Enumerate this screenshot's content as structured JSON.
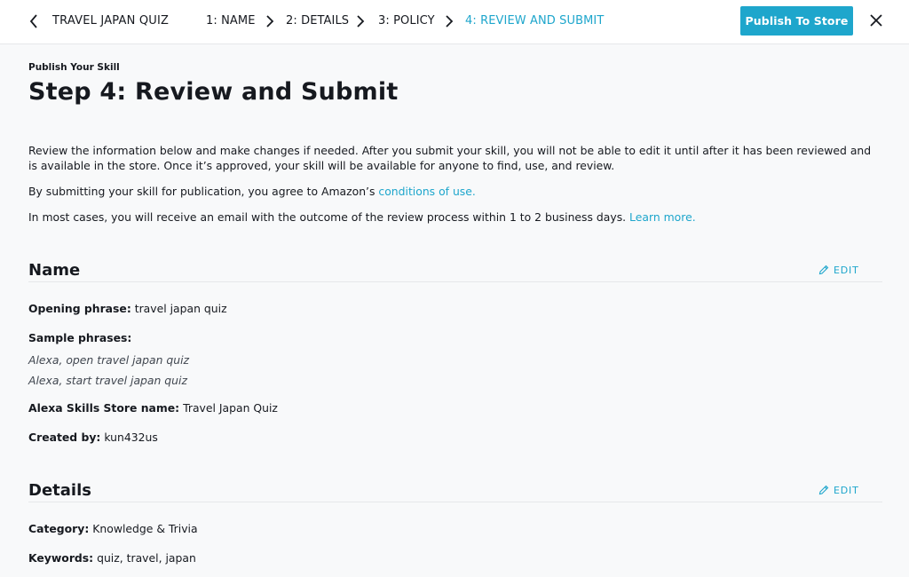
{
  "header": {
    "skill_name": "TRAVEL JAPAN QUIZ",
    "steps": [
      {
        "label": "1: NAME"
      },
      {
        "label": "2: DETAILS"
      },
      {
        "label": "3: POLICY"
      },
      {
        "label": "4: REVIEW AND SUBMIT",
        "active": true
      }
    ],
    "publish_label": "Publish To Store"
  },
  "page": {
    "eyebrow": "Publish Your Skill",
    "title": "Step 4: Review and Submit",
    "intro": "Review the information below and make changes if needed. After you submit your skill, you will not be able to edit it until after it has been reviewed and is available in the store. Once it’s approved, your skill will be available for anyone to find, use, and review.",
    "agree_text": "By submitting your skill for publication, you agree to Amazon’s ",
    "agree_link": "conditions of use.",
    "email_text": "In most cases, you will receive an email with the outcome of the review process within 1 to 2 business days. ",
    "email_link": "Learn more."
  },
  "sections": {
    "name": {
      "title": "Name",
      "edit_label": "EDIT",
      "opening_phrase_label": "Opening phrase:",
      "opening_phrase": "travel japan quiz",
      "sample_phrases_label": "Sample phrases:",
      "sample_phrases": [
        "Alexa, open travel japan quiz",
        "Alexa, start travel japan quiz"
      ],
      "store_name_label": "Alexa Skills Store name:",
      "store_name": "Travel Japan Quiz",
      "created_by_label": "Created by:",
      "created_by": "kun432us"
    },
    "details": {
      "title": "Details",
      "edit_label": "EDIT",
      "category_label": "Category:",
      "category": "Knowledge & Trivia",
      "keywords_label": "Keywords:",
      "keywords": "quiz, travel, japan"
    }
  },
  "colors": {
    "accent": "#1ea6cc",
    "text": "#16191f",
    "background": "#f8f9fa"
  }
}
